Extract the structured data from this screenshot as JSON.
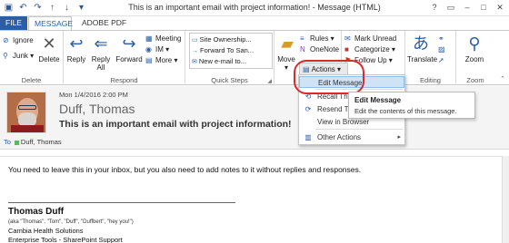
{
  "window": {
    "title": "This is an important email with project information! - Message (HTML)",
    "help_label": "?",
    "qat_icons": [
      "save-icon",
      "undo-icon",
      "redo-icon",
      "up-icon",
      "down-icon",
      "customize-icon"
    ]
  },
  "tabs": [
    "FILE",
    "MESSAGE",
    "ADOBE PDF"
  ],
  "ribbon": {
    "delete_group": {
      "label": "Delete",
      "ignore": "Ignore",
      "junk": "Junk",
      "delete": "Delete"
    },
    "respond_group": {
      "label": "Respond",
      "reply": "Reply",
      "reply_all": "Reply All",
      "forward": "Forward",
      "meeting": "Meeting",
      "im": "IM",
      "more": "More"
    },
    "quick_steps": {
      "label": "Quick Steps",
      "items": [
        "Site Ownership...",
        "Forward To San...",
        "New e-mail to..."
      ]
    },
    "move_group": {
      "label": "Move",
      "move": "Move",
      "rules": "Rules",
      "onenote": "OneNote",
      "actions": "Actions"
    },
    "tags_group": {
      "mark_unread": "Mark Unread",
      "categorize": "Categorize",
      "follow_up": "Follow Up"
    },
    "editing_group": {
      "label": "Editing",
      "translate": "Translate"
    },
    "zoom_group": {
      "label": "Zoom",
      "zoom": "Zoom"
    }
  },
  "actions_menu": {
    "items": [
      {
        "label": "Edit Message",
        "active": true,
        "icon": "edit-icon"
      },
      {
        "label": "Recall This Message...",
        "active": false,
        "icon": "recall-icon"
      },
      {
        "label": "Resend This Message...",
        "active": false,
        "icon": "resend-icon"
      },
      {
        "label": "View in Browser",
        "active": false,
        "icon": ""
      },
      {
        "label": "Other Actions",
        "active": false,
        "icon": "other-actions-icon",
        "submenu": true
      }
    ]
  },
  "tooltip": {
    "title": "Edit Message",
    "description": "Edit the contents of this message."
  },
  "message": {
    "date": "Mon 1/4/2016 2:00 PM",
    "sender": "Duff, Thomas",
    "subject": "This is an important email with project information!",
    "to_label": "To",
    "to_name": "Duff, Thomas",
    "body": "You need to leave this in your inbox, but you also need to add notes to it without replies and responses.",
    "signature": {
      "name": "Thomas Duff",
      "aka": "(aka \"Thomas\", \"Tom\", \"Duff\", \"Duffbert\", \"hey you!\")",
      "org": "Cambia Health Solutions",
      "dept": "Enterprise Tools - SharePoint Support"
    }
  },
  "colors": {
    "accent": "#2a5ea7",
    "highlight_circle": "#d72b2b",
    "menu_active": "#cfe3f7"
  }
}
